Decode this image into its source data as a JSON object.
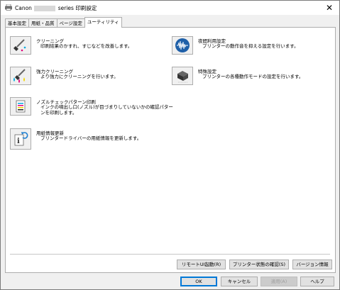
{
  "window": {
    "title_prefix": "Canon",
    "title_suffix": "series 印刷設定",
    "close_glyph": "✕"
  },
  "tabs": [
    {
      "label": "基本設定",
      "active": false
    },
    {
      "label": "用紙・品質",
      "active": false
    },
    {
      "label": "ページ設定",
      "active": false
    },
    {
      "label": "ユーティリティ",
      "active": true
    }
  ],
  "utilities": {
    "cleaning": {
      "title": "クリーニング",
      "desc": "印刷結果のかすれ、すじなどを改善します。",
      "icon": "cleaning-icon"
    },
    "deep_cleaning": {
      "title": "強力クリーニング",
      "desc": "より強力にクリーニングを行います。",
      "icon": "deep-cleaning-icon"
    },
    "nozzle_check": {
      "title": "ノズルチェックパターン印刷",
      "desc_line1": "インクの噴出し口(ノズル)が目づまりしていないかの確認パター",
      "desc_line2": "ンを印刷します。",
      "icon": "nozzle-check-icon"
    },
    "media_update": {
      "title": "用紙情報更新",
      "desc": "プリンタードライバーの用紙情報を更新します。",
      "icon": "media-info-update-icon"
    },
    "quiet_mode": {
      "title": "夜間利用設定",
      "desc": "プリンターの動作音を抑える設定を行います。",
      "icon": "quiet-mode-icon"
    },
    "custom_settings": {
      "title": "特殊設定",
      "desc": "プリンターの各種動作モードの設定を行います。",
      "icon": "custom-settings-icon"
    }
  },
  "panel_buttons": {
    "remote_ui": "リモートUI起動(R)",
    "printer_status": "プリンター状態の確認(S)",
    "version": "バージョン情報"
  },
  "dialog_buttons": {
    "ok": "OK",
    "cancel": "キャンセル",
    "apply": "適用(A)",
    "help": "ヘルプ"
  },
  "colors": {
    "accent": "#0078d7",
    "quiet_mode_blue": "#1e5fa8",
    "ink_cyan": "#00a8e0",
    "ink_magenta": "#e0007a",
    "ink_yellow": "#f2d800"
  }
}
